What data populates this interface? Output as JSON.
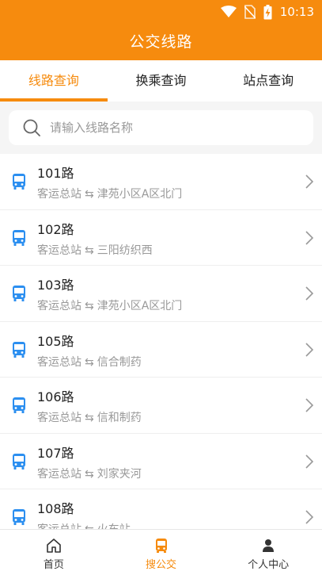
{
  "status": {
    "time": "10:13"
  },
  "header": {
    "title": "公交线路"
  },
  "tabs": [
    {
      "label": "线路查询",
      "active": true
    },
    {
      "label": "换乘查询",
      "active": false
    },
    {
      "label": "站点查询",
      "active": false
    }
  ],
  "search": {
    "placeholder": "请输入线路名称",
    "value": ""
  },
  "routes": [
    {
      "name": "101路",
      "from": "客运总站",
      "to": "津苑小区A区北门"
    },
    {
      "name": "102路",
      "from": "客运总站",
      "to": "三阳纺织西"
    },
    {
      "name": "103路",
      "from": "客运总站",
      "to": "津苑小区A区北门"
    },
    {
      "name": "105路",
      "from": "客运总站",
      "to": "信合制药"
    },
    {
      "name": "106路",
      "from": "客运总站",
      "to": "信和制药"
    },
    {
      "name": "107路",
      "from": "客运总站",
      "to": "刘家夹河"
    },
    {
      "name": "108路",
      "from": "客运总站",
      "to": "火车站"
    }
  ],
  "arrow_glyph": "⇆",
  "bottom_nav": [
    {
      "label": "首页",
      "icon": "home-icon",
      "active": false
    },
    {
      "label": "搜公交",
      "icon": "bus-icon",
      "active": true
    },
    {
      "label": "个人中心",
      "icon": "person-icon",
      "active": false
    }
  ],
  "colors": {
    "accent": "#f68b0e",
    "bus_icon": "#2c8ff0"
  }
}
